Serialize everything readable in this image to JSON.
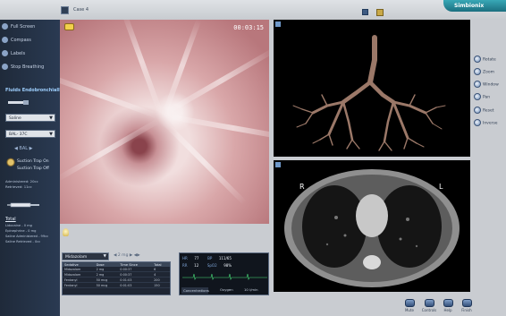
{
  "header": {
    "case_title": "Case 4",
    "brand": "Simbionix"
  },
  "sidebar": {
    "items": [
      {
        "label": "Full Screen",
        "icon": "fullscreen-icon"
      },
      {
        "label": "Compass",
        "icon": "compass-icon"
      },
      {
        "label": "Labels",
        "icon": "labels-icon"
      },
      {
        "label": "Stop Breathing",
        "icon": "breathing-icon"
      }
    ],
    "fluids_title": "Fluids Endobronchially",
    "fluid_select": "Saline",
    "temp_select": "BAL- 37C",
    "nav_arrows": "◀  BAL  ▶",
    "suction_on": "Suction Trap On",
    "suction_off": "Suction Trap Off",
    "administered": "Administered: 20cc",
    "retrieved": "Retrieved: 11cc",
    "total_title": "Total",
    "totals": [
      "Lidocaine - 0 mg",
      "Epinephrine - 0 mg",
      "Saline Administered - 99cc",
      "Saline Retrieved - 0cc"
    ]
  },
  "endoscope": {
    "timer": "00:03:15"
  },
  "ct": {
    "left_label": "L",
    "right_label": "R"
  },
  "tools": [
    {
      "label": "Rotate",
      "icon": "rotate-icon"
    },
    {
      "label": "Zoom",
      "icon": "zoom-icon"
    },
    {
      "label": "Window",
      "icon": "window-icon"
    },
    {
      "label": "Pan",
      "icon": "pan-icon"
    },
    {
      "label": "Reset",
      "icon": "reset-icon"
    },
    {
      "label": "Inverse",
      "icon": "inverse-icon"
    }
  ],
  "medication": {
    "selected_drug": "Midazolam",
    "dose_controls": "◀  2 mg  ▶  ◀▶",
    "columns": [
      "Sedative",
      "Dose",
      "Time Since",
      "Total"
    ],
    "rows": [
      [
        "Midazolam",
        "2 mg",
        "0:00:37",
        "6"
      ],
      [
        "Midazolam",
        "2 mg",
        "0:00:37",
        "4"
      ],
      [
        "Fentanyl",
        "50 mcg",
        "0:01:03",
        "200"
      ],
      [
        "Fentanyl",
        "50 mcg",
        "0:01:03",
        "150"
      ]
    ]
  },
  "vitals": {
    "hr_label": "HR",
    "hr_value": "77",
    "bp_label": "BP",
    "bp_value": "111/65",
    "rr_label": "RR",
    "rr_value": "12",
    "spo2_label": "SpO2",
    "spo2_value": "98%",
    "concentrations": "Concentrations",
    "oxygen": "Oxygen",
    "flow": "10 l/min"
  },
  "bottom_buttons": [
    {
      "label": "Mute",
      "icon": "mute-icon"
    },
    {
      "label": "Controls",
      "icon": "controls-icon"
    },
    {
      "label": "Help",
      "icon": "help-icon"
    },
    {
      "label": "Finish",
      "icon": "finish-icon"
    }
  ]
}
